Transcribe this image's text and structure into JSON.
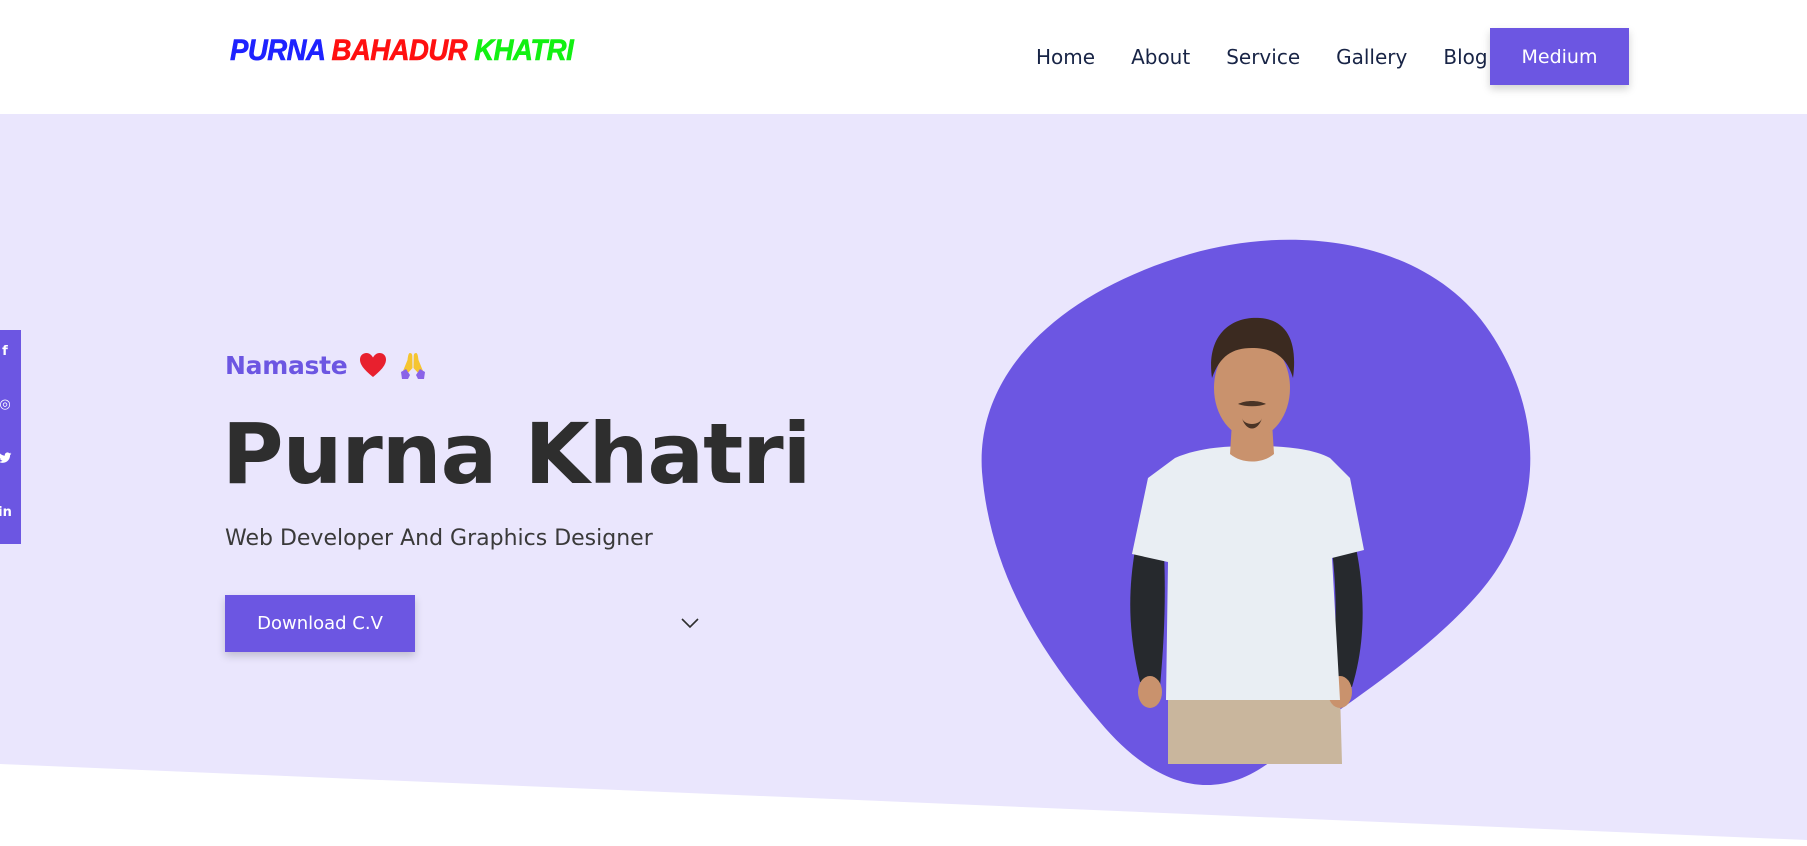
{
  "header": {
    "logo": {
      "word1": "PURNA",
      "word2": "BAHADUR",
      "word3": "KHATRI"
    },
    "nav": [
      "Home",
      "About",
      "Service",
      "Gallery",
      "Blog"
    ],
    "cta_label": "Medium"
  },
  "social": {
    "icons": [
      "facebook-icon",
      "instagram-icon",
      "twitter-icon",
      "linkedin-icon"
    ],
    "glyphs": {
      "facebook": "f",
      "instagram": "◎",
      "twitter": "✓",
      "linkedin": "in"
    }
  },
  "hero": {
    "greeting": "Namaste",
    "greeting_emoji": [
      "red-heart-icon",
      "folded-hands-icon"
    ],
    "name": "Purna Khatri",
    "role": "Web Developer And Graphics Designer",
    "download_label": "Download C.V"
  },
  "colors": {
    "accent": "#6c56e2",
    "hero_bg": "#eae6fd",
    "heading": "#2e2e2e",
    "nav_text": "#182446",
    "logo_word1": "#1e22ff",
    "logo_word2": "#ff1010",
    "logo_word3": "#12f012"
  }
}
